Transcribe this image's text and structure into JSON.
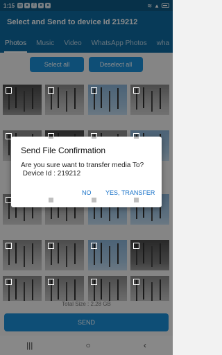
{
  "status_bar": {
    "time": "1:15"
  },
  "app_bar": {
    "title": "Select and Send to device Id 219212"
  },
  "tabs": [
    {
      "label": "Photos"
    },
    {
      "label": "Music"
    },
    {
      "label": "Video"
    },
    {
      "label": "WhatsApp Photos"
    },
    {
      "label": "wha"
    }
  ],
  "actions": {
    "select_all": "Select all",
    "deselect_all": "Deselect all"
  },
  "footer": {
    "total_size": "Total Size : 2.28 GB",
    "send": "SEND"
  },
  "dialog": {
    "title": "Send File Confirmation",
    "message_line1": "Are you sure want to transfer media To?",
    "message_line2": " Device Id : 219212",
    "no": "NO",
    "yes": "YES, TRANSFER"
  },
  "nav": {
    "recents": "|||",
    "home": "○",
    "back": "‹"
  }
}
